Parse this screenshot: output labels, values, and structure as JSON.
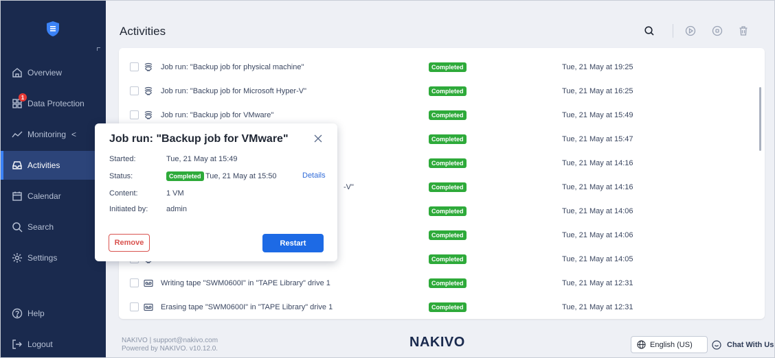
{
  "sidebar": {
    "logo": "shield-logo",
    "items": [
      {
        "label": "Overview",
        "icon": "home-icon"
      },
      {
        "label": "Data Protection",
        "icon": "grid-icon",
        "badge": "1"
      },
      {
        "label": "Monitoring",
        "icon": "chart-line-icon",
        "chevron": "<"
      },
      {
        "label": "Activities",
        "icon": "inbox-icon",
        "active": true
      },
      {
        "label": "Calendar",
        "icon": "calendar-icon"
      },
      {
        "label": "Search",
        "icon": "search-icon"
      },
      {
        "label": "Settings",
        "icon": "gear-icon"
      },
      {
        "label": "Help",
        "icon": "help-icon"
      },
      {
        "label": "Logout",
        "icon": "logout-icon"
      }
    ]
  },
  "header": {
    "title": "Activities",
    "toolbar": [
      "search-icon",
      "play-icon",
      "stop-icon",
      "trash-icon"
    ]
  },
  "activities": [
    {
      "icon": "backup-job-icon",
      "name": "Job run: \"Backup job for physical machine\"",
      "status": "Completed",
      "time": "Tue, 21 May at 19:25"
    },
    {
      "icon": "backup-job-icon",
      "name": "Job run: \"Backup job for Microsoft Hyper-V\"",
      "status": "Completed",
      "time": "Tue, 21 May at 16:25"
    },
    {
      "icon": "backup-job-icon",
      "name": "Job run: \"Backup job for VMware\"",
      "status": "Completed",
      "time": "Tue, 21 May at 15:49"
    },
    {
      "icon": "backup-job-icon",
      "name": "",
      "status": "Completed",
      "time": "Tue, 21 May at 15:47"
    },
    {
      "icon": "backup-job-icon",
      "name": "",
      "status": "Completed",
      "time": "Tue, 21 May at 14:16"
    },
    {
      "icon": "backup-job-icon",
      "name": "-V\"",
      "status": "Completed",
      "time": "Tue, 21 May at 14:16"
    },
    {
      "icon": "backup-job-icon",
      "name": "",
      "status": "Completed",
      "time": "Tue, 21 May at 14:06"
    },
    {
      "icon": "backup-job-icon",
      "name": "",
      "status": "Completed",
      "time": "Tue, 21 May at 14:06"
    },
    {
      "icon": "backup-job-icon",
      "name": "",
      "status": "Completed",
      "time": "Tue, 21 May at 14:05"
    },
    {
      "icon": "tape-icon",
      "name": "Writing tape \"SWM0600I\" in \"TAPE Library\" drive 1",
      "status": "Completed",
      "time": "Tue, 21 May at 12:31"
    },
    {
      "icon": "tape-icon",
      "name": "Erasing tape \"SWM0600I\" in \"TAPE Library\" drive 1",
      "status": "Completed",
      "time": "Tue, 21 May at 12:31"
    }
  ],
  "popup": {
    "title": "Job run: \"Backup job for VMware\"",
    "started_label": "Started:",
    "started_value": "Tue, 21 May at 15:49",
    "status_label": "Status:",
    "status_badge": "Completed",
    "status_value": "Tue, 21 May at 15:50",
    "details_link": "Details",
    "content_label": "Content:",
    "content_value": "1 VM",
    "initiated_label": "Initiated by:",
    "initiated_value": "admin",
    "remove_label": "Remove",
    "restart_label": "Restart"
  },
  "footer": {
    "line1": "NAKIVO | support@nakivo.com",
    "line2": "Powered by NAKIVO. v10.12.0.",
    "brand": "NAKIVO",
    "language": "English (US)",
    "chat": "Chat With Us"
  },
  "colors": {
    "sidebar": "#1a2a4e",
    "sidebar_active": "#2c4479",
    "completed": "#2eaa3a",
    "primary": "#1d6ae5",
    "danger": "#d9534f"
  }
}
